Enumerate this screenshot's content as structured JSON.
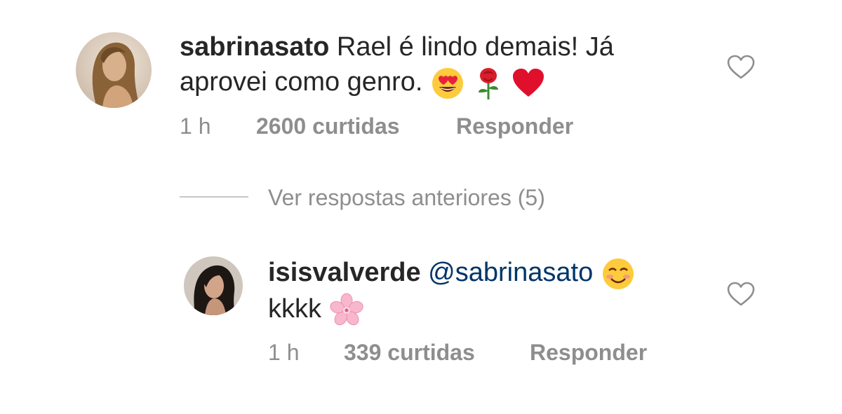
{
  "comments": [
    {
      "username": "sabrinasato",
      "text": "Rael é lindo demais! Já aprovei como genro.",
      "emojis": [
        "heart-eyes-emoji",
        "rose-emoji",
        "red-heart-emoji"
      ],
      "time": "1 h",
      "likes": "2600 curtidas",
      "reply_label": "Responder"
    },
    {
      "username": "isisvalverde",
      "mention": "@sabrinasato",
      "text": "kkkk",
      "emojis": [
        "smiling-blush-emoji",
        "cherry-blossom-emoji"
      ],
      "time": "1 h",
      "likes": "339 curtidas",
      "reply_label": "Responder"
    }
  ],
  "view_replies_label": "Ver respostas anteriores (5)",
  "colors": {
    "text": "#262626",
    "meta": "#8e8e8e",
    "mention": "#003569",
    "divider": "#c7c7c7"
  }
}
